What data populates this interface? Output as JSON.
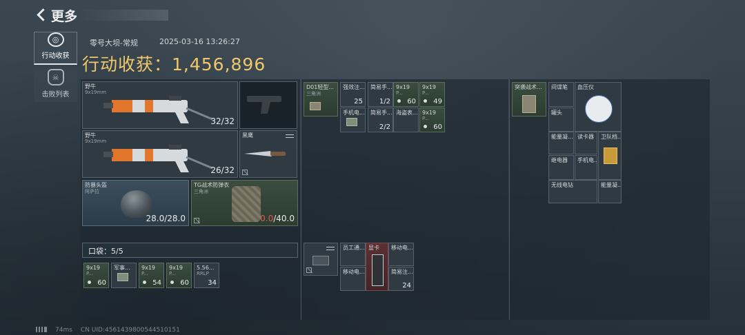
{
  "header": {
    "title": "更多"
  },
  "nav": [
    {
      "label": "行动收获",
      "icon": "loot-icon"
    },
    {
      "label": "击败列表",
      "icon": "skull-icon"
    }
  ],
  "match": {
    "map": "零号大坝-常规",
    "datetime": "2025-03-16 13:26:27",
    "loot_label": "行动收获：1,456,896"
  },
  "equipment": {
    "primary": {
      "name": "野牛",
      "caliber": "9x19mm",
      "ammo": "32/32"
    },
    "secondary": {
      "name": "野牛",
      "caliber": "9x19mm",
      "ammo": "26/32"
    },
    "pistol": {
      "name": ""
    },
    "melee": {
      "name": "黑鹰"
    },
    "helmet": {
      "name": "防暴头盔",
      "sub": "阿萨拉",
      "durability": "28.0/28.0"
    },
    "armor": {
      "name": "TG战术防弹衣",
      "sub": "三角洲",
      "durability_current": "0.0",
      "durability_max": "/40.0"
    }
  },
  "pouch": {
    "title": "口袋：5/5",
    "items": [
      {
        "name": "9x19",
        "sub": "P...",
        "count": "60"
      },
      {
        "name": "军事...",
        "sub": "",
        "count": ""
      },
      {
        "name": "9x19",
        "sub": "P...",
        "count": "54"
      },
      {
        "name": "9x19",
        "sub": "P...",
        "count": "60"
      },
      {
        "name": "5.56...",
        "sub": "RRLP",
        "count": "34"
      }
    ]
  },
  "chest_rig": {
    "name": "D01轻型...",
    "sub": "三角洲",
    "items": [
      {
        "name": "强效注...",
        "count": "25"
      },
      {
        "name": "简易手...",
        "count": "1/2"
      },
      {
        "name": "9x19",
        "sub": "P...",
        "count": "60"
      },
      {
        "name": "9x19",
        "sub": "P...",
        "count": "49"
      },
      {
        "name": "手机电...",
        "count": ""
      },
      {
        "name": "简易手...",
        "count": "2/2"
      },
      {
        "name": "海盗表...",
        "count": ""
      },
      {
        "name": "9x19",
        "sub": "P...",
        "count": "60"
      }
    ]
  },
  "case": {
    "items": [
      {
        "name": "员工通...",
        "count": ""
      },
      {
        "name": "显卡",
        "count": ""
      },
      {
        "name": "移动电...",
        "count": ""
      },
      {
        "name": "移动电...",
        "count": ""
      },
      {
        "name": "简易注...",
        "count": "24"
      }
    ]
  },
  "backpack": {
    "name": "突袭战术...",
    "sub": "",
    "items": [
      {
        "name": "间谍笔"
      },
      {
        "name": "血压仪"
      },
      {
        "name": "罐头"
      },
      {
        "name": "能量凝..."
      },
      {
        "name": "读卡器"
      },
      {
        "name": "卫队档..."
      },
      {
        "name": "继电器"
      },
      {
        "name": "手机电..."
      },
      {
        "name": "无线电钻"
      },
      {
        "name": "能量凝..."
      }
    ]
  },
  "footer": {
    "ping": "74ms",
    "uid": "CN UID:4561439800544510151"
  }
}
